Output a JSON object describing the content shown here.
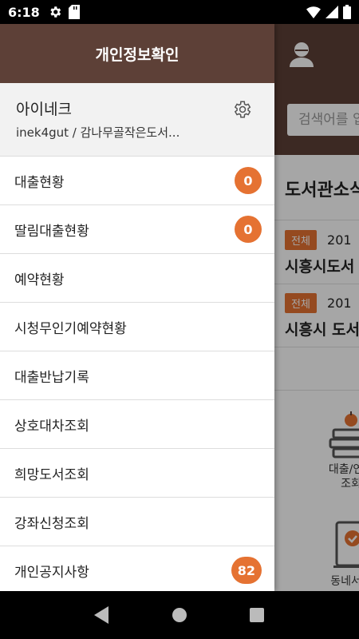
{
  "status_bar": {
    "time": "6:18",
    "left_icons": [
      "settings-icon",
      "sd-card-icon"
    ],
    "right_icons": [
      "wifi-icon",
      "signal-icon",
      "battery-icon"
    ]
  },
  "drawer": {
    "title": "개인정보확인",
    "profile": {
      "name": "아이네크",
      "detail": "inek4gut / 감나무골작은도서..."
    },
    "menu": [
      {
        "label": "대출현황",
        "badge": "0"
      },
      {
        "label": "딸림대출현황",
        "badge": "0"
      },
      {
        "label": "예약현황",
        "badge": null
      },
      {
        "label": "시청무인기예약현황",
        "badge": null
      },
      {
        "label": "대출반납기록",
        "badge": null
      },
      {
        "label": "상호대차조회",
        "badge": null
      },
      {
        "label": "희망도서조회",
        "badge": null
      },
      {
        "label": "강좌신청조회",
        "badge": null
      },
      {
        "label": "개인공지사항",
        "badge": "82"
      }
    ]
  },
  "background": {
    "search_placeholder": "검색어를 입",
    "section_title": "도서관소식",
    "notices": [
      {
        "badge": "전체",
        "date": "201",
        "title": "시흥시도서"
      },
      {
        "badge": "전체",
        "date": "201",
        "title": "시흥시 도서"
      }
    ],
    "tiles": [
      {
        "label_line1": "대출/연장",
        "label_line2": "조회"
      },
      {
        "label_line1": "동네서점",
        "label_line2": ""
      }
    ]
  },
  "colors": {
    "header_brown": "#5d4037",
    "accent_orange": "#e57232"
  }
}
